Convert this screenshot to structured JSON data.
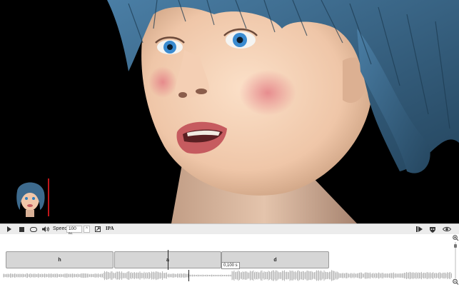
{
  "toolbar": {
    "speed_label": "Speed",
    "speed_value": "100 %",
    "ipa_label": "IPA"
  },
  "timeline": {
    "phonemes": [
      {
        "label": "h"
      },
      {
        "label": "a"
      },
      {
        "label": "d"
      }
    ],
    "tooltip": "0,100 s"
  },
  "colors": {
    "hair": "#3d6a8d",
    "skin": "#f1c7a9",
    "eye_iris": "#2e7fc0",
    "lips": "#c65b5f",
    "marker": "#c0161a"
  }
}
